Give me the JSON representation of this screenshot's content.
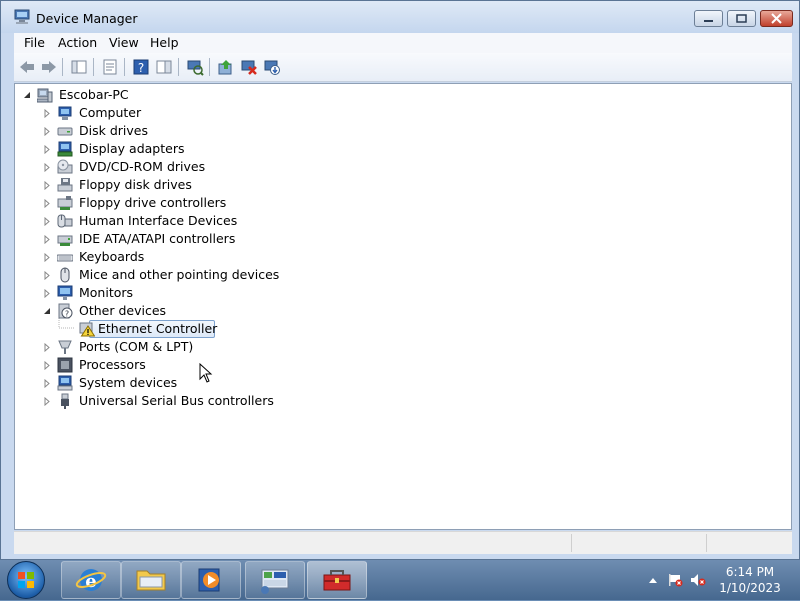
{
  "window": {
    "title": "Device Manager"
  },
  "menu": [
    "File",
    "Action",
    "View",
    "Help"
  ],
  "tree": {
    "root": "Escobar-PC",
    "categories": [
      {
        "label": "Computer"
      },
      {
        "label": "Disk drives"
      },
      {
        "label": "Display adapters"
      },
      {
        "label": "DVD/CD-ROM drives"
      },
      {
        "label": "Floppy disk drives"
      },
      {
        "label": "Floppy drive controllers"
      },
      {
        "label": "Human Interface Devices"
      },
      {
        "label": "IDE ATA/ATAPI controllers"
      },
      {
        "label": "Keyboards"
      },
      {
        "label": "Mice and other pointing devices"
      },
      {
        "label": "Monitors"
      },
      {
        "label": "Other devices",
        "children": [
          {
            "label": "Ethernet Controller",
            "selected": true,
            "warning": true
          }
        ]
      },
      {
        "label": "Ports (COM & LPT)"
      },
      {
        "label": "Processors"
      },
      {
        "label": "System devices"
      },
      {
        "label": "Universal Serial Bus controllers"
      }
    ]
  },
  "taskbar": {
    "clock_time": "6:14 PM",
    "clock_date": "1/10/2023"
  }
}
